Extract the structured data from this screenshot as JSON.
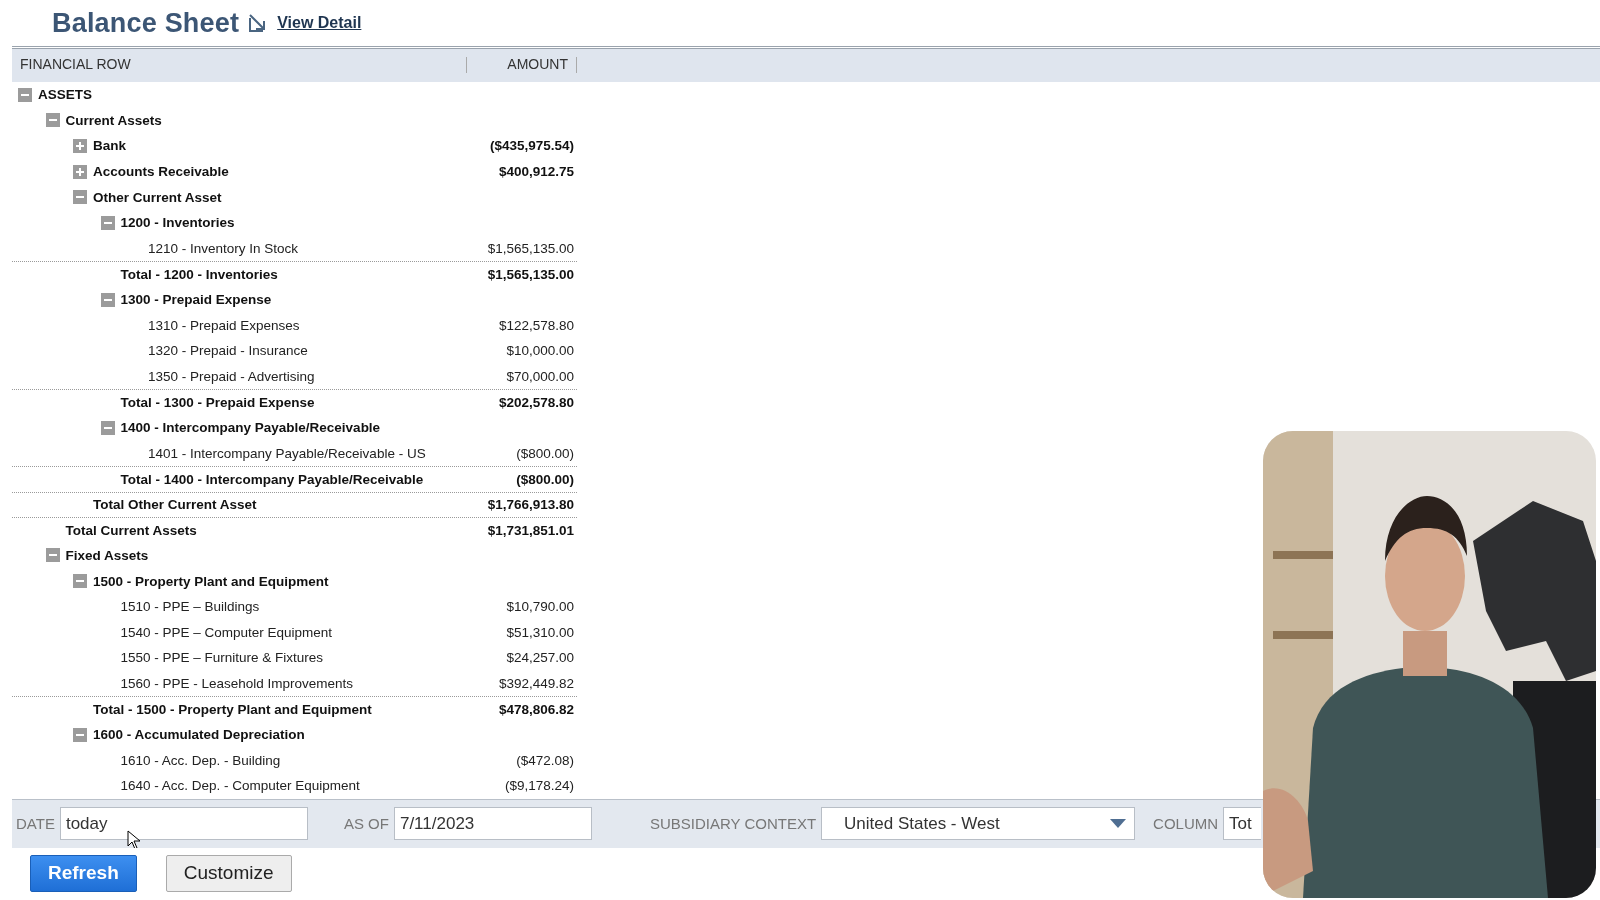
{
  "header": {
    "title": "Balance Sheet",
    "link": "View Detail"
  },
  "table": {
    "columns": [
      "FINANCIAL ROW",
      "AMOUNT"
    ],
    "rows": [
      {
        "label": "ASSETS",
        "expanded": true,
        "children": [
          {
            "label": "Current Assets",
            "expanded": true,
            "children": [
              {
                "label": "Bank",
                "expanded": false,
                "amount": "($435,975.54)"
              },
              {
                "label": "Accounts Receivable",
                "expanded": false,
                "amount": "$400,912.75"
              },
              {
                "label": "Other Current Asset",
                "expanded": true,
                "children": [
                  {
                    "label": "1200 - Inventories",
                    "expanded": true,
                    "children": [
                      {
                        "label": "1210 - Inventory In Stock",
                        "amount": "$1,565,135.00"
                      }
                    ],
                    "total": {
                      "label": "Total - 1200 - Inventories",
                      "amount": "$1,565,135.00"
                    }
                  },
                  {
                    "label": "1300 - Prepaid Expense",
                    "expanded": true,
                    "children": [
                      {
                        "label": "1310 - Prepaid Expenses",
                        "amount": "$122,578.80"
                      },
                      {
                        "label": "1320 - Prepaid - Insurance",
                        "amount": "$10,000.00"
                      },
                      {
                        "label": "1350 - Prepaid - Advertising",
                        "amount": "$70,000.00"
                      }
                    ],
                    "total": {
                      "label": "Total - 1300 - Prepaid Expense",
                      "amount": "$202,578.80"
                    }
                  },
                  {
                    "label": "1400 - Intercompany Payable/Receivable",
                    "expanded": true,
                    "children": [
                      {
                        "label": "1401 - Intercompany Payable/Receivable - US",
                        "amount": "($800.00)"
                      }
                    ],
                    "total": {
                      "label": "Total - 1400 - Intercompany Payable/Receivable",
                      "amount": "($800.00)"
                    }
                  }
                ],
                "total": {
                  "label": "Total Other Current Asset",
                  "amount": "$1,766,913.80"
                }
              }
            ],
            "total": {
              "label": "Total Current Assets",
              "amount": "$1,731,851.01"
            }
          },
          {
            "label": "Fixed Assets",
            "expanded": true,
            "children": [
              {
                "label": "1500 - Property Plant and Equipment",
                "expanded": true,
                "children": [
                  {
                    "label": "1510 - PPE – Buildings",
                    "amount": "$10,790.00"
                  },
                  {
                    "label": "1540 - PPE – Computer Equipment",
                    "amount": "$51,310.00"
                  },
                  {
                    "label": "1550 - PPE – Furniture & Fixtures",
                    "amount": "$24,257.00"
                  },
                  {
                    "label": "1560 - PPE - Leasehold Improvements",
                    "amount": "$392,449.82"
                  }
                ],
                "total": {
                  "label": "Total - 1500 - Property Plant and Equipment",
                  "amount": "$478,806.82"
                }
              },
              {
                "label": "1600 - Accumulated Depreciation",
                "expanded": true,
                "children": [
                  {
                    "label": "1610 - Acc. Dep. - Building",
                    "amount": "($472.08)"
                  },
                  {
                    "label": "1640 - Acc. Dep. - Computer Equipment",
                    "amount": "($9,178.24)"
                  }
                ]
              }
            ]
          }
        ]
      }
    ]
  },
  "filters": [
    {
      "kind": "text",
      "label": "DATE",
      "value": "today"
    },
    {
      "kind": "text",
      "label": "AS OF",
      "value": "7/11/2023"
    },
    {
      "kind": "select",
      "label": "SUBSIDIARY CONTEXT",
      "value": "United States - West"
    },
    {
      "kind": "text",
      "label": "COLUMN",
      "value": "Tot"
    }
  ],
  "buttons": [
    {
      "label": "Refresh",
      "primary": true
    },
    {
      "label": "Customize",
      "primary": false
    }
  ]
}
